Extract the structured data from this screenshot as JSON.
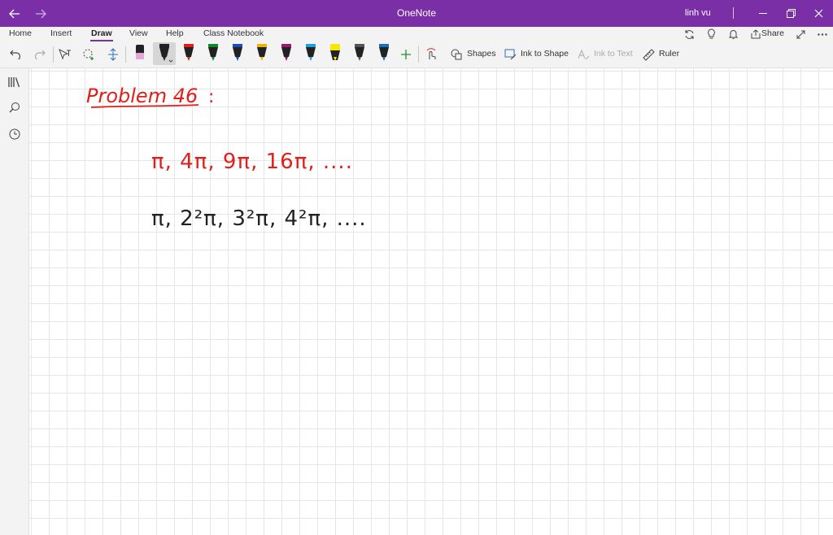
{
  "window": {
    "title": "OneNote",
    "user": "linh vu"
  },
  "tabs": [
    {
      "label": "Home"
    },
    {
      "label": "Insert"
    },
    {
      "label": "Draw",
      "active": true
    },
    {
      "label": "View"
    },
    {
      "label": "Help"
    },
    {
      "label": "Class Notebook"
    }
  ],
  "share_label": "Share",
  "tools": {
    "shapes_label": "Shapes",
    "ink_to_shape_label": "Ink to Shape",
    "ink_to_text_label": "Ink to Text",
    "ruler_label": "Ruler"
  },
  "pen_colors": [
    "#e8a4d8",
    "#222222",
    "#e0201b",
    "#0f8a2b",
    "#1b4fb5",
    "#f0b400",
    "#a0156f",
    "#19a1e0",
    "#f7e600",
    "#555555",
    "#1b6fb5"
  ],
  "note": {
    "heading": "Problem 46",
    "line1": "π, 4π, 9π, 16π, ....",
    "line2": "π, 2²π, 3²π, 4²π, ....",
    "colors": {
      "heading": "#e0201b",
      "line1": "#e0201b",
      "line2": "#222222"
    }
  }
}
